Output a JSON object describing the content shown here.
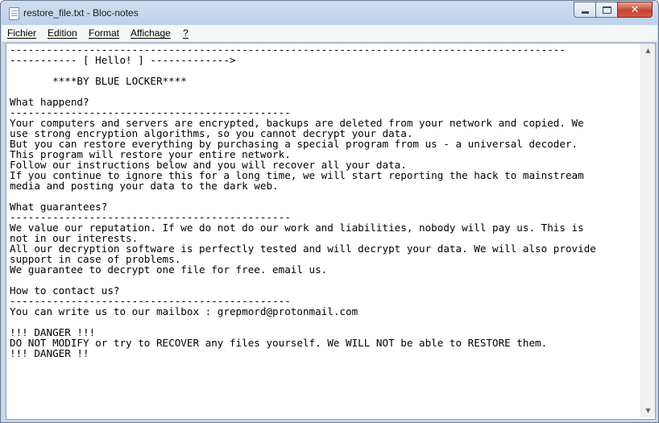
{
  "window": {
    "title": "restore_file.txt - Bloc-notes"
  },
  "icons": {
    "app": "notepad-icon",
    "minimize": "minimize-icon",
    "maximize": "maximize-icon",
    "close": "close-icon",
    "scroll_up": "scroll-up-arrow-icon",
    "scroll_down": "scroll-down-arrow-icon"
  },
  "caption": {
    "close_glyph": "✕",
    "up_glyph": "▲",
    "down_glyph": "▼"
  },
  "menu": {
    "file": "Fichier",
    "edit": "Edition",
    "format": "Format",
    "view": "Affichage",
    "help": "?"
  },
  "document": {
    "content": "-------------------------------------------------------------------------------------------\n----------- [ Hello! ] ------------->\n\n       ****BY BLUE LOCKER****\n\nWhat happend?\n----------------------------------------------\nYour computers and servers are encrypted, backups are deleted from your network and copied. We\nuse strong encryption algorithms, so you cannot decrypt your data.\nBut you can restore everything by purchasing a special program from us - a universal decoder.\nThis program will restore your entire network.\nFollow our instructions below and you will recover all your data.\nIf you continue to ignore this for a long time, we will start reporting the hack to mainstream\nmedia and posting your data to the dark web.\n\nWhat guarantees?\n----------------------------------------------\nWe value our reputation. If we do not do our work and liabilities, nobody will pay us. This is\nnot in our interests.\nAll our decryption software is perfectly tested and will decrypt your data. We will also provide\nsupport in case of problems.\nWe guarantee to decrypt one file for free. email us.\n\nHow to contact us?\n----------------------------------------------\nYou can write us to our mailbox : grepmord@protonmail.com\n\n!!! DANGER !!!\nDO NOT MODIFY or try to RECOVER any files yourself. We WILL NOT be able to RESTORE them.\n!!! DANGER !!"
  }
}
